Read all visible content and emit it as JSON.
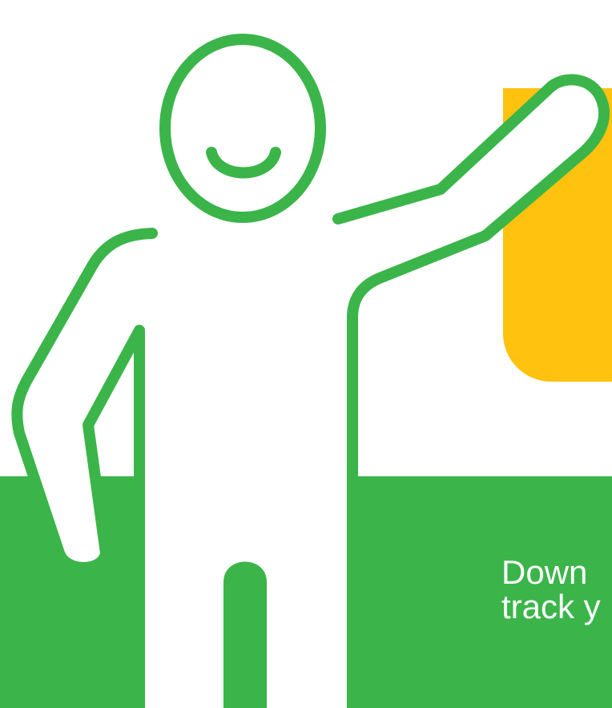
{
  "colors": {
    "green": "#3bb54a",
    "yellow": "#ffc20e",
    "white": "#ffffff"
  },
  "illustration": {
    "icon": "waving-person-icon"
  },
  "promo": {
    "line1": "Down",
    "line2": "track y"
  }
}
